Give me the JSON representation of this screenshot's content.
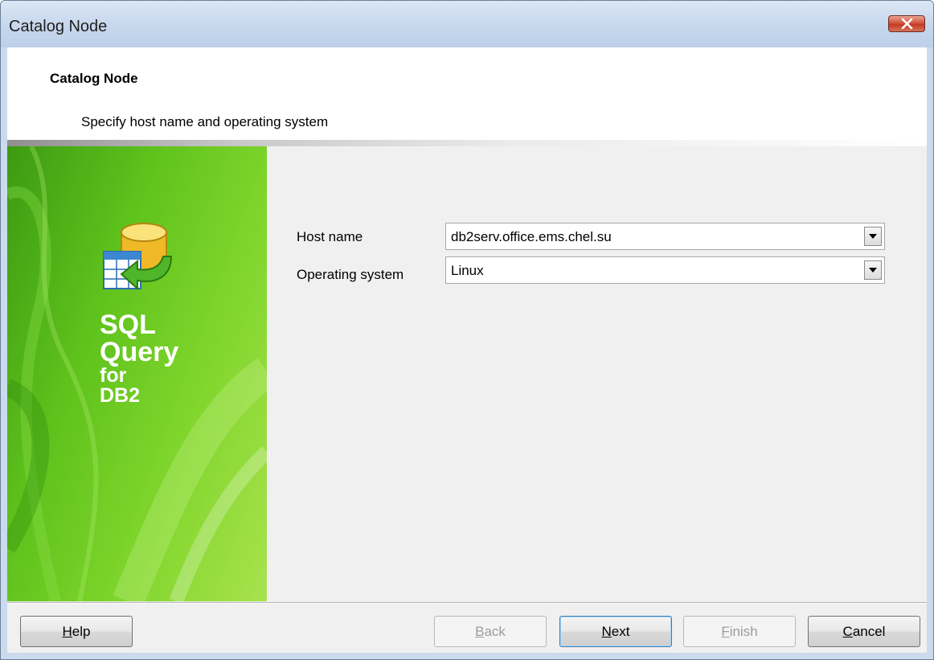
{
  "window": {
    "title": "Catalog Node"
  },
  "header": {
    "title": "Catalog Node",
    "subtitle": "Specify host name and operating system"
  },
  "sidebar": {
    "brand_line1": "SQL",
    "brand_line2": "Query",
    "brand_line3": "for",
    "brand_line4": "DB2",
    "logo_icon": "database-arrow-icon"
  },
  "form": {
    "host_name": {
      "label": "Host name",
      "value": "db2serv.office.ems.chel.su"
    },
    "operating_system": {
      "label": "Operating system",
      "value": "Linux"
    }
  },
  "buttons": {
    "help": {
      "label_u": "H",
      "label_rest": "elp"
    },
    "back": {
      "label_u": "B",
      "label_rest": "ack"
    },
    "next": {
      "label_u": "N",
      "label_rest": "ext"
    },
    "finish": {
      "label_u": "F",
      "label_rest": "inish"
    },
    "cancel": {
      "label_u": "C",
      "label_rest": "ancel"
    }
  },
  "colors": {
    "sidebar_green": "#5fc21c",
    "close_red": "#c33b26",
    "titlebar_blue": "#c6d7ec"
  }
}
